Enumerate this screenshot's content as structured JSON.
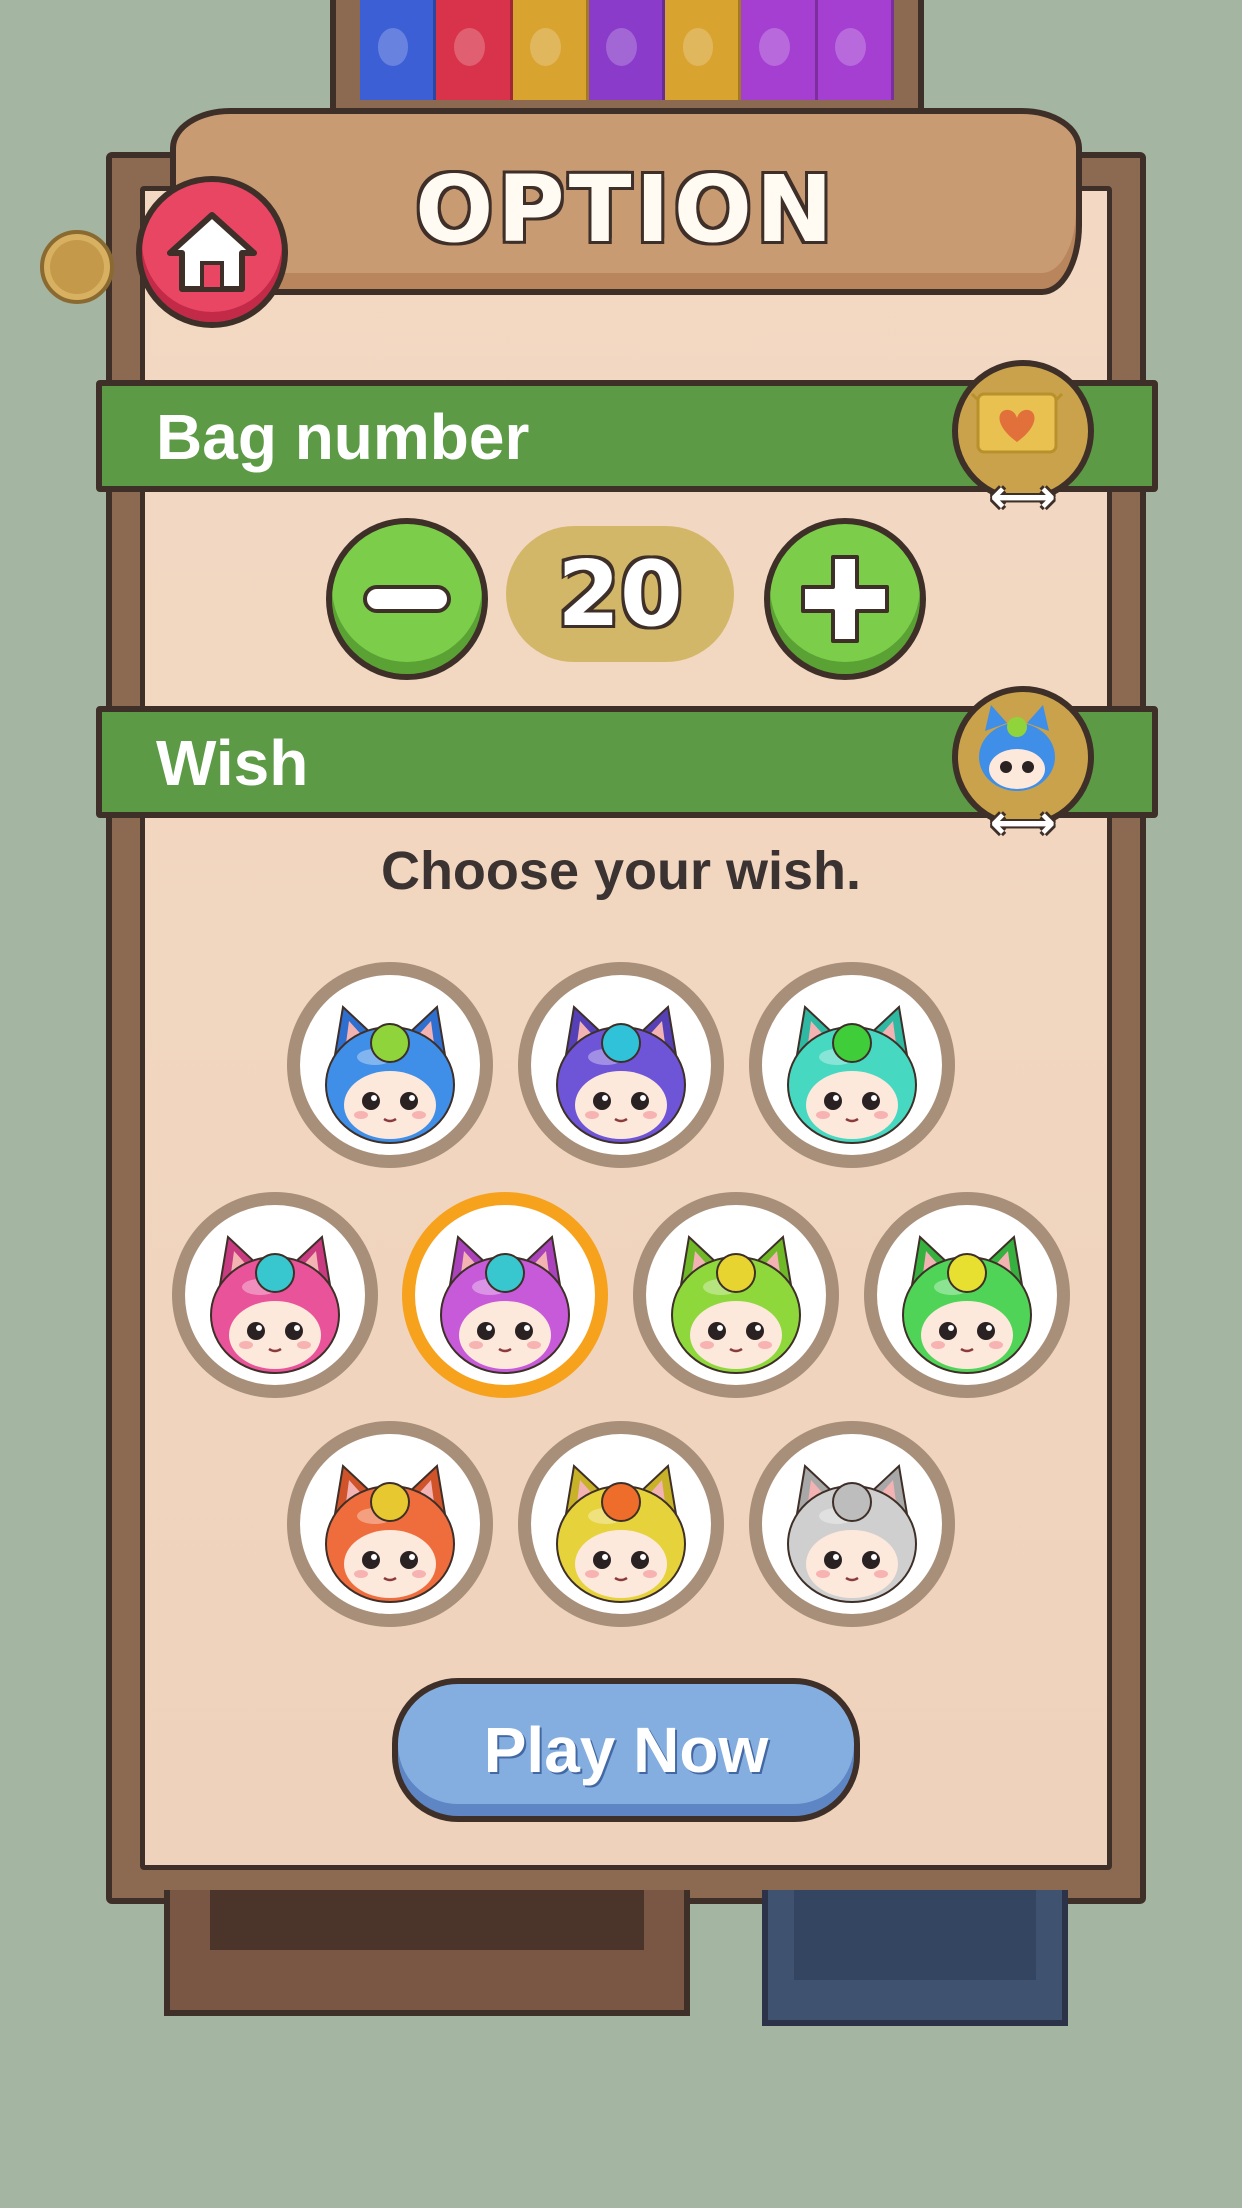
{
  "title": "OPTION",
  "home_button": {
    "icon": "home-icon"
  },
  "bag_number": {
    "label": "Bag number",
    "badge_icon": "candy-bag-icon",
    "decrement_icon": "minus-icon",
    "increment_icon": "plus-icon",
    "value": "20"
  },
  "wish": {
    "label": "Wish",
    "badge_icon": "blue-cat-character-icon",
    "prompt": "Choose your wish.",
    "selected_index": 4,
    "options": [
      {
        "name": "blue-cat",
        "body": "#3f8ee8",
        "ball": "#8fd43a",
        "ear": "#2f6fd0"
      },
      {
        "name": "purple-cat",
        "body": "#6e54d6",
        "ball": "#2fc2d8",
        "ear": "#5540b8"
      },
      {
        "name": "teal-cat",
        "body": "#46d8c0",
        "ball": "#3fce3a",
        "ear": "#2fb8a2"
      },
      {
        "name": "pink-cat",
        "body": "#e8539a",
        "ball": "#38c7cf",
        "ear": "#c93b80"
      },
      {
        "name": "magenta-cat",
        "body": "#c65ad8",
        "ball": "#38c7cf",
        "ear": "#a942bb"
      },
      {
        "name": "lime-cat",
        "body": "#8fd83c",
        "ball": "#e8d430",
        "ear": "#6fb828"
      },
      {
        "name": "green-cat",
        "body": "#4fd457",
        "ball": "#e8e030",
        "ear": "#36b03e"
      },
      {
        "name": "orange-cat",
        "body": "#ef6d3c",
        "ball": "#e8c830",
        "ear": "#d0532a"
      },
      {
        "name": "yellow-cat",
        "body": "#e6d23a",
        "ball": "#ee6d2a",
        "ear": "#c8b228"
      },
      {
        "name": "grey-cat",
        "body": "#cfcfcf",
        "ball": "#bdbdbd",
        "ear": "#a8a8a8"
      }
    ]
  },
  "play_button": {
    "label": "Play Now"
  },
  "shelf_bag_colors": [
    "#3d5fd6",
    "#d8334a",
    "#d9a330",
    "#8a3bc9",
    "#d9a330",
    "#a43fd1",
    "#a43fd1"
  ]
}
